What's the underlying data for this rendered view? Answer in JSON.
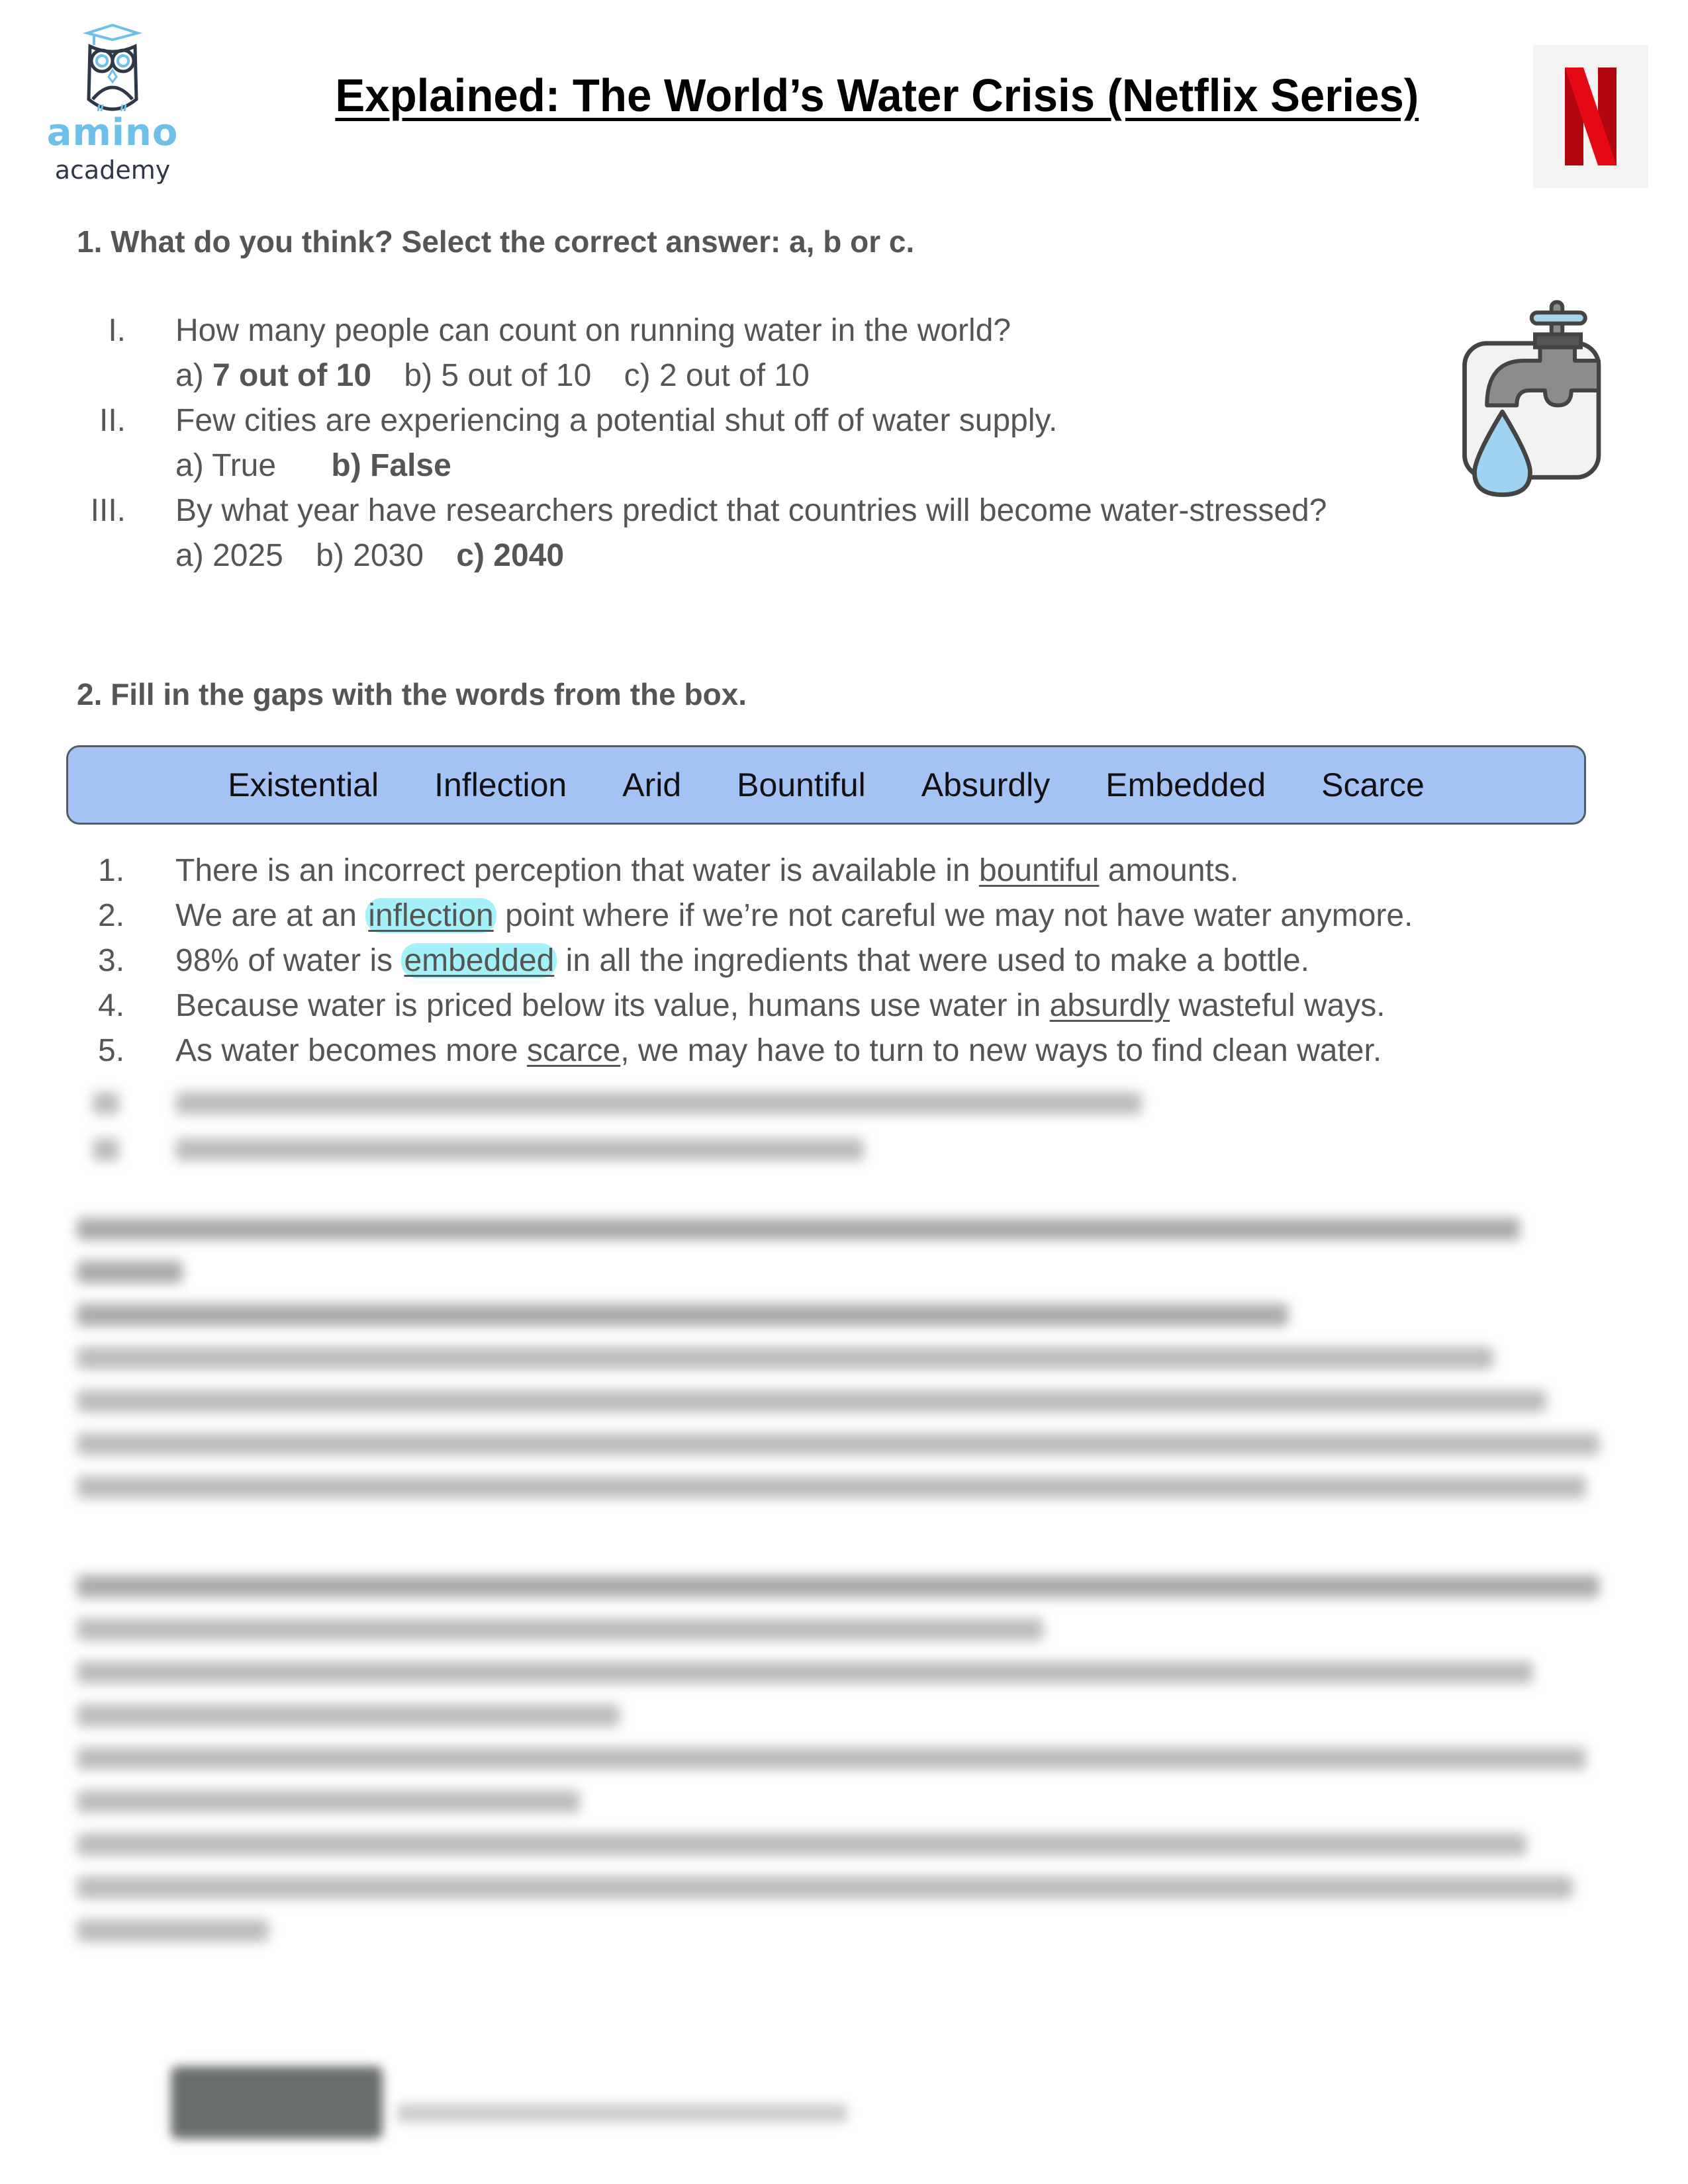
{
  "header": {
    "logo": {
      "brand": "amino",
      "sub": "academy",
      "icon": "owl-graduate-icon"
    },
    "title": "Explained: The World’s Water Crisis (Netflix Series)",
    "netflix_icon": "netflix-logo-icon",
    "colors": {
      "logo_blue": "#6ec0e8",
      "logo_dark": "#2e3848",
      "netflix_red": "#e50914"
    }
  },
  "section1": {
    "heading": "1. What do you think? Select the correct answer: a, b or c.",
    "illustration": "water-tap-drop-icon",
    "questions": [
      {
        "numeral": "I.",
        "text": "How many people can count on running water in the world?",
        "options": [
          {
            "label": "a) ",
            "value": "7 out of 10",
            "selected": true
          },
          {
            "label": "b) ",
            "value": "5 out of 10",
            "selected": false
          },
          {
            "label": "c) ",
            "value": "2 out of 10",
            "selected": false
          }
        ]
      },
      {
        "numeral": "II.",
        "text": "Few cities are experiencing a potential shut off of water supply.",
        "options": [
          {
            "label": "a) ",
            "value": "True",
            "selected": false
          },
          {
            "label": "b) ",
            "value": "False",
            "selected": true
          }
        ]
      },
      {
        "numeral": "III.",
        "text": "By what year have researchers predict that countries will become water-stressed?",
        "options": [
          {
            "label": "a) ",
            "value": "2025",
            "selected": false
          },
          {
            "label": "b) ",
            "value": "2030",
            "selected": false
          },
          {
            "label": "c) ",
            "value": "2040",
            "selected": true
          }
        ]
      }
    ]
  },
  "section2": {
    "heading": "2. Fill in the gaps with the words from the box.",
    "word_box": [
      "Existential",
      "Inflection",
      "Arid",
      "Bountiful",
      "Absurdly",
      "Embedded",
      "Scarce"
    ],
    "word_box_color": "#a4c2f4",
    "sentences": [
      {
        "num": "1.",
        "before": "There is an incorrect perception that water is available in ",
        "answer": "bountiful",
        "after": " amounts.",
        "highlighted": false
      },
      {
        "num": "2.",
        "before": "We are at an ",
        "answer": "inflection",
        "after": " point where if we’re not careful we may not have water anymore.",
        "highlighted": true
      },
      {
        "num": "3.",
        "before": "98% of water is ",
        "answer": "embedded",
        "after": " in all the ingredients that were used to make a bottle.",
        "highlighted": true
      },
      {
        "num": "4.",
        "before": "Because water is priced below its value, humans use water in ",
        "answer": "absurdly",
        "after": " wasteful ways.",
        "highlighted": false
      },
      {
        "num": "5.",
        "before": "As water becomes more ",
        "answer": "scarce",
        "after": ", we may have to turn to new ways to find clean water.",
        "highlighted": false
      }
    ],
    "highlight_color": "#5ae6f0"
  },
  "blurred_content": {
    "note": "Remaining content (items 6-7, section 3 and footer) is blurred and illegible"
  }
}
